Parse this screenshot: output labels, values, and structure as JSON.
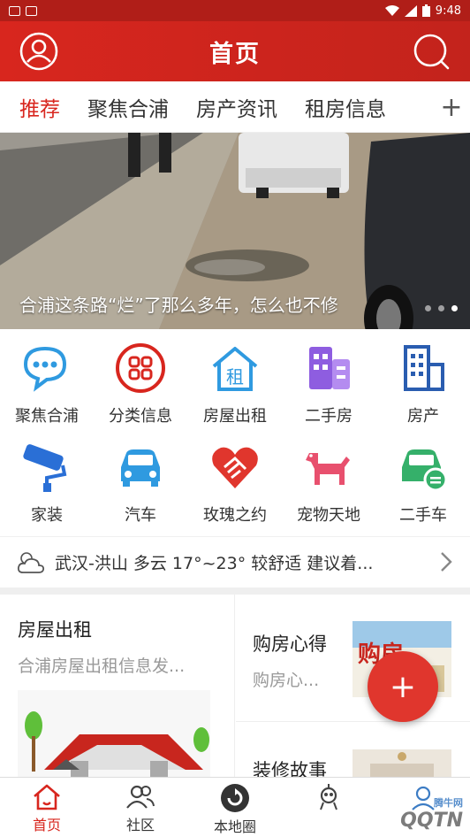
{
  "status_bar": {
    "time": "9:48"
  },
  "header": {
    "title": "首页",
    "user_icon": "user-icon",
    "search_icon": "search-icon"
  },
  "tabs": [
    {
      "label": "推荐",
      "active": true
    },
    {
      "label": "聚焦合浦",
      "active": false
    },
    {
      "label": "房产资讯",
      "active": false
    },
    {
      "label": "租房信息",
      "active": false
    }
  ],
  "tabs_add": "+",
  "banner": {
    "caption": "合浦这条路“烂”了那么多年，怎么也不修",
    "slide_count": 3,
    "active_slide": 2
  },
  "grid": [
    {
      "label": "聚焦合浦",
      "icon": "chat-bubble-icon",
      "color": "#2f9ae0"
    },
    {
      "label": "分类信息",
      "icon": "category-icon",
      "color": "#d8261e"
    },
    {
      "label": "房屋出租",
      "icon": "house-rent-icon",
      "color": "#2f9ae0"
    },
    {
      "label": "二手房",
      "icon": "buildings-icon",
      "color": "#8e5de0"
    },
    {
      "label": "房产",
      "icon": "office-building-icon",
      "color": "#2a5db0"
    },
    {
      "label": "家装",
      "icon": "paint-roller-icon",
      "color": "#2a6fd6"
    },
    {
      "label": "汽车",
      "icon": "car-icon",
      "color": "#2f9ae0"
    },
    {
      "label": "玫瑰之约",
      "icon": "heart-hands-icon",
      "color": "#e0362d"
    },
    {
      "label": "宠物天地",
      "icon": "dog-icon",
      "color": "#e8506e"
    },
    {
      "label": "二手车",
      "icon": "used-car-icon",
      "color": "#35b06a"
    }
  ],
  "weather": {
    "text": "武汉-洪山 多云 17°~23° 较舒适 建议着...",
    "icon": "cloud-sun-icon"
  },
  "cards": {
    "left": {
      "title": "房屋出租",
      "desc": "合浦房屋出租信息发..."
    },
    "right_top": {
      "title": "购房心得",
      "desc": "购房心...",
      "image_text": "购房"
    },
    "right_bottom": {
      "title": "装修故事"
    }
  },
  "fab": {
    "label": "+"
  },
  "bottom_nav": [
    {
      "label": "首页",
      "icon": "home-icon",
      "active": true
    },
    {
      "label": "社区",
      "icon": "community-icon",
      "active": false
    },
    {
      "label": "本地圈",
      "icon": "local-circle-icon",
      "active": false
    },
    {
      "label": "",
      "icon": "robot-icon",
      "active": false
    },
    {
      "label": "",
      "icon": "profile-icon",
      "active": false
    }
  ],
  "watermark": {
    "brand": "腾牛网",
    "text": "QQTN"
  },
  "colors": {
    "primary": "#d8261e",
    "text": "#333333",
    "muted": "#999999"
  }
}
